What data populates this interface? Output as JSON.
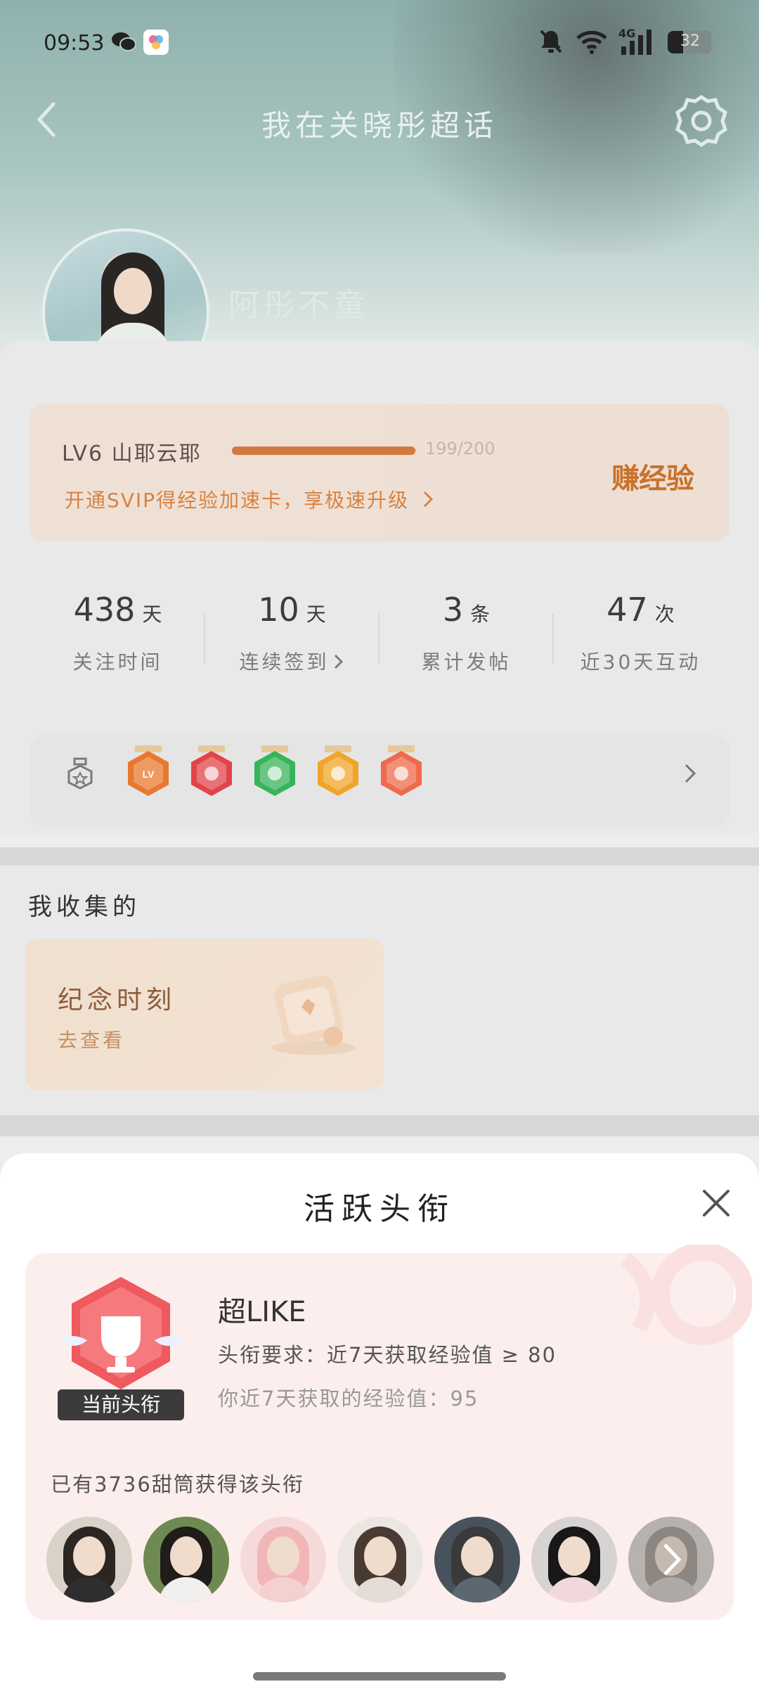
{
  "status_bar": {
    "time": "09:53",
    "network": "4G",
    "battery": "32",
    "icons": [
      "wechat-icon",
      "app-icon",
      "mute-icon",
      "wifi-icon",
      "signal-icon",
      "battery-icon"
    ]
  },
  "header": {
    "title": "我在关晓彤超话",
    "nickname": "阿彤不童"
  },
  "level": {
    "label": "LV6 山耶云耶",
    "progress": 0.995,
    "count": "199/200",
    "svip_text": "开通SVIP得经验加速卡，享极速升级",
    "earn_button": "赚经验"
  },
  "stats": [
    {
      "value": "438",
      "unit": "天",
      "label": "关注时间"
    },
    {
      "value": "10",
      "unit": "天",
      "label": "连续签到"
    },
    {
      "value": "3",
      "unit": "条",
      "label": "累计发帖"
    },
    {
      "value": "47",
      "unit": "次",
      "label": "近30天互动"
    }
  ],
  "medals": [
    {
      "name": "lv-medal-icon",
      "color": "#e8782f",
      "text": "LV"
    },
    {
      "name": "trophy-medal-icon",
      "color": "#e0444a",
      "text": ""
    },
    {
      "name": "hand-medal-icon",
      "color": "#37b45a",
      "text": ""
    },
    {
      "name": "laugh-medal-icon",
      "color": "#f0a52a",
      "text": ""
    },
    {
      "name": "gesture-medal-icon",
      "color": "#ee6a4c",
      "text": ""
    }
  ],
  "collection": {
    "title": "我收集的",
    "moment_title": "纪念时刻",
    "moment_sub": "去查看"
  },
  "sheet": {
    "title": "活跃头衔",
    "badge_tag": "当前头衔",
    "title_name": "超LIKE",
    "requirement": "头衔要求：近7天获取经验值 ≥ 80",
    "mine": "你近7天获取的经验值：95",
    "owners": "已有3736甜筒获得该头衔"
  },
  "owner_avatars": [
    {
      "hair": "#2b2622",
      "body": "#2e2e2e",
      "bg": "#d9d2c8"
    },
    {
      "hair": "#1f1c1a",
      "body": "#f2f0ee",
      "bg": "#6e8a52"
    },
    {
      "hair": "#f2b6b8",
      "body": "#f4d0d0",
      "bg": "#f6dada"
    },
    {
      "hair": "#4a3a34",
      "body": "#e6dcd6",
      "bg": "#ece6e2"
    },
    {
      "hair": "#3a3a3a",
      "body": "#5c6770",
      "bg": "#47525c"
    },
    {
      "hair": "#181818",
      "body": "#f1d8dc",
      "bg": "#d7d3d2"
    },
    {
      "hair": "#9a8f86",
      "body": "#c9c3bd",
      "bg": "#d6d2ce"
    }
  ]
}
